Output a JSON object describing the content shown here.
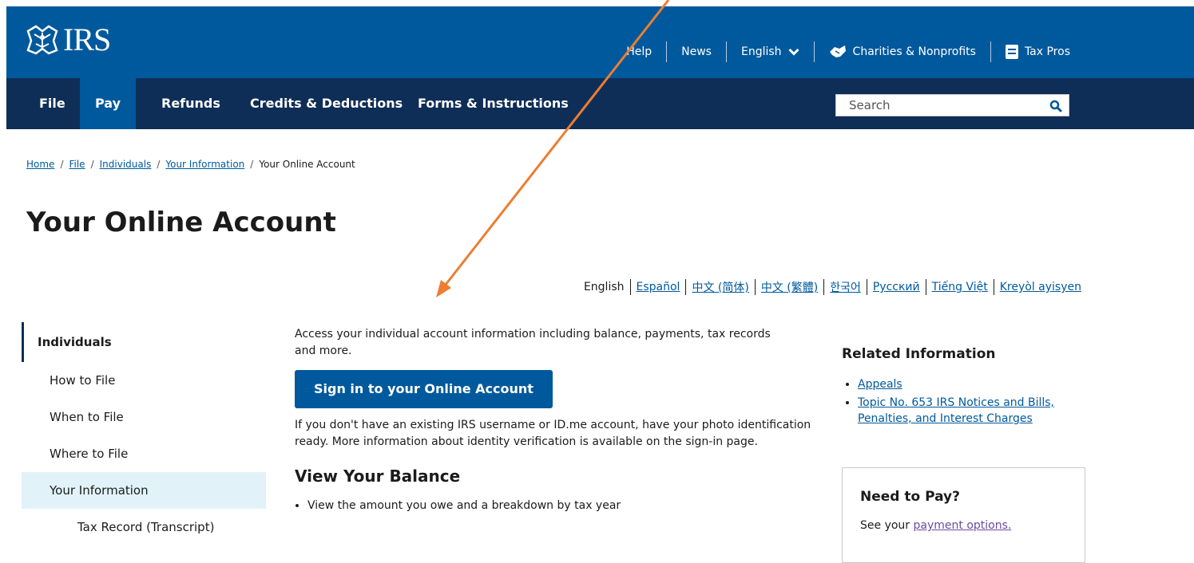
{
  "colors": {
    "header_blue": "#00599c",
    "nav_navy": "#0f2e57",
    "link_blue": "#00599c",
    "sidebar_active": "#e1f3f8",
    "annotation_arrow": "#ed7d31",
    "visited_link": "#6b4ba0"
  },
  "header": {
    "logo_text": "IRS",
    "logo_icon": "irs-eagle-icon",
    "utility": {
      "help": "Help",
      "news": "News",
      "language": "English",
      "language_icon": "chevron-down-icon",
      "charities": "Charities & Nonprofits",
      "charities_icon": "handshake-icon",
      "tax_pros": "Tax Pros",
      "tax_pros_icon": "document-icon"
    },
    "nav": [
      {
        "label": "File"
      },
      {
        "label": "Pay",
        "active": true
      },
      {
        "label": "Refunds"
      },
      {
        "label": "Credits & Deductions"
      },
      {
        "label": "Forms & Instructions"
      }
    ],
    "search": {
      "placeholder": "Search",
      "icon": "search-icon"
    }
  },
  "breadcrumb": {
    "items": [
      "Home",
      "File",
      "Individuals",
      "Your Information"
    ],
    "current": "Your Online Account"
  },
  "page_title": "Your Online Account",
  "languages": {
    "current": "English",
    "links": [
      "Español",
      "中文 (简体)",
      "中文 (繁體)",
      "한국어",
      "Русский",
      "Tiếng Việt",
      "Kreyòl ayisyen"
    ]
  },
  "sidebar": {
    "heading": "Individuals",
    "items": [
      {
        "label": "How to File"
      },
      {
        "label": "When to File"
      },
      {
        "label": "Where to File"
      },
      {
        "label": "Your Information",
        "active": true
      },
      {
        "label": "Tax Record (Transcript)",
        "sub": true
      }
    ]
  },
  "main": {
    "intro": "Access your individual account information including balance, payments, tax records and more.",
    "sign_in_button": "Sign in to your Online Account",
    "note": "If you don't have an existing IRS username or ID.me account, have your photo identification ready. More information about identity verification is available on the sign-in page.",
    "view_balance": {
      "heading": "View Your Balance",
      "bullets": [
        "View the amount you owe and a breakdown by tax year"
      ]
    }
  },
  "related": {
    "heading": "Related Information",
    "links": [
      "Appeals",
      "Topic No. 653 IRS Notices and Bills, Penalties, and Interest Charges"
    ]
  },
  "need_to_pay": {
    "heading": "Need to Pay?",
    "text_before": "See your ",
    "link": "payment options."
  }
}
